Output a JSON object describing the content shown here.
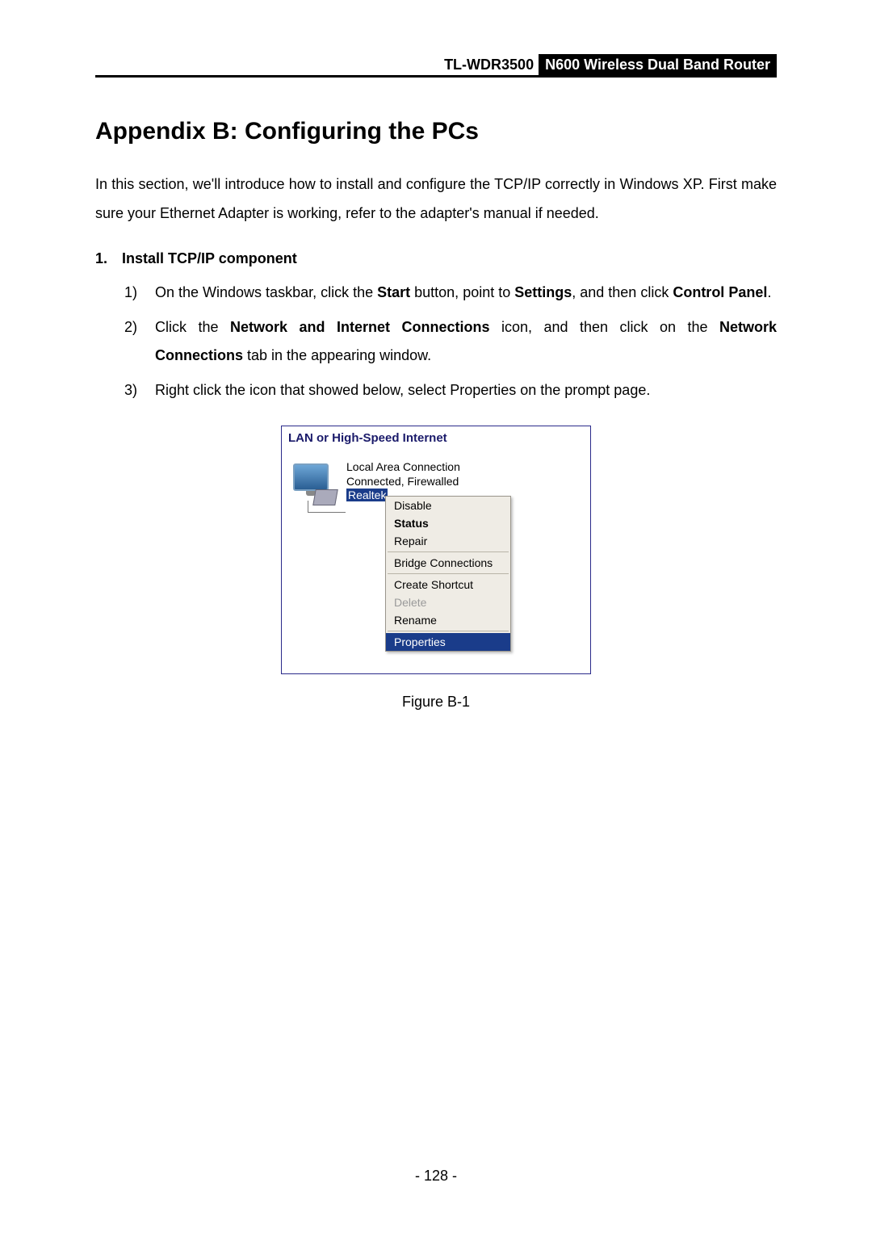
{
  "header": {
    "model": "TL-WDR3500",
    "product": "N600 Wireless Dual Band Router"
  },
  "title": "Appendix B: Configuring the PCs",
  "intro": "In this section, we'll introduce how to install and configure the TCP/IP correctly in Windows XP. First make sure your Ethernet Adapter is working, refer to the adapter's manual if needed.",
  "section": {
    "number": "1.",
    "heading": "Install TCP/IP component"
  },
  "steps": [
    {
      "marker": "1)",
      "parts": [
        {
          "t": "On the Windows taskbar, click the "
        },
        {
          "t": "Start",
          "b": true
        },
        {
          "t": " button, point to "
        },
        {
          "t": "Settings",
          "b": true
        },
        {
          "t": ", and then click "
        },
        {
          "t": "Control Panel",
          "b": true
        },
        {
          "t": "."
        }
      ]
    },
    {
      "marker": "2)",
      "parts": [
        {
          "t": "Click the "
        },
        {
          "t": "Network and Internet Connections",
          "b": true
        },
        {
          "t": " icon, and then click on the "
        },
        {
          "t": "Network Connections",
          "b": true
        },
        {
          "t": " tab in the appearing window."
        }
      ]
    },
    {
      "marker": "3)",
      "parts": [
        {
          "t": "Right click the icon that showed below, select Properties on the prompt page."
        }
      ]
    }
  ],
  "figure": {
    "header": "LAN or High-Speed Internet",
    "connection": {
      "line1": "Local Area Connection",
      "line2": "Connected, Firewalled",
      "line3": "Realtek"
    },
    "menu": {
      "disable": "Disable",
      "status": "Status",
      "repair": "Repair",
      "bridge": "Bridge Connections",
      "shortcut": "Create Shortcut",
      "delete": "Delete",
      "rename": "Rename",
      "properties": "Properties"
    },
    "caption": "Figure B-1"
  },
  "pageNumber": "- 128 -"
}
